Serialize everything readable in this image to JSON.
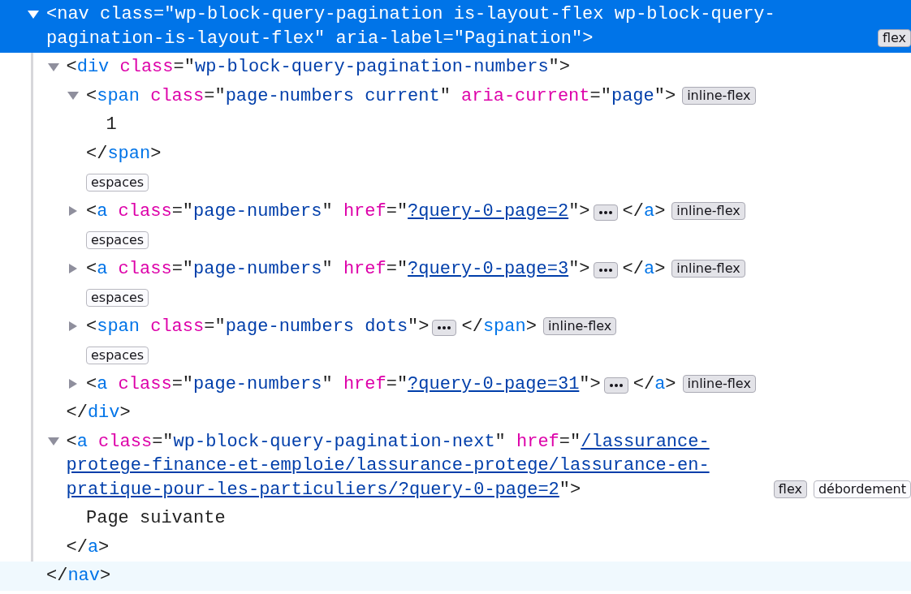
{
  "syntax": {
    "open": "<",
    "open_end": ">",
    "close": "</",
    "equals": "=",
    "quote": "\""
  },
  "tree": [
    {
      "kind": "element",
      "tag": "nav",
      "close_tag": "nav",
      "selected": true,
      "expanded": true,
      "close_hovered": true,
      "attributes": [
        {
          "name": "class",
          "value": "wp-block-query-pagination is-layout-flex wp-block-query-pagination-is-layout-flex",
          "link": false
        },
        {
          "name": "aria-label",
          "value": "Pagination",
          "link": false
        }
      ],
      "badges": [
        {
          "label": "flex",
          "kind": "display"
        }
      ],
      "children": [
        {
          "kind": "element",
          "tag": "div",
          "close_tag": "div",
          "selected": false,
          "expanded": true,
          "attributes": [
            {
              "name": "class",
              "value": "wp-block-query-pagination-numbers",
              "link": false
            }
          ],
          "children": [
            {
              "kind": "element",
              "tag": "span",
              "close_tag": "span",
              "selected": false,
              "expanded": true,
              "attributes": [
                {
                  "name": "class",
                  "value": "page-numbers current",
                  "link": false
                },
                {
                  "name": "aria-current",
                  "value": "page",
                  "link": false
                }
              ],
              "badges": [
                {
                  "label": "inline-flex",
                  "kind": "display"
                }
              ],
              "children": [
                {
                  "kind": "text",
                  "text": "1"
                }
              ]
            },
            {
              "kind": "whitespace",
              "label": "espaces"
            },
            {
              "kind": "element",
              "tag": "a",
              "close_tag": "a",
              "selected": false,
              "expanded": false,
              "attributes": [
                {
                  "name": "class",
                  "value": "page-numbers",
                  "link": false
                },
                {
                  "name": "href",
                  "value": "?query-0-page=2",
                  "link": true
                }
              ],
              "badges": [
                {
                  "label": "inline-flex",
                  "kind": "display"
                }
              ]
            },
            {
              "kind": "whitespace",
              "label": "espaces"
            },
            {
              "kind": "element",
              "tag": "a",
              "close_tag": "a",
              "selected": false,
              "expanded": false,
              "attributes": [
                {
                  "name": "class",
                  "value": "page-numbers",
                  "link": false
                },
                {
                  "name": "href",
                  "value": "?query-0-page=3",
                  "link": true
                }
              ],
              "badges": [
                {
                  "label": "inline-flex",
                  "kind": "display"
                }
              ]
            },
            {
              "kind": "whitespace",
              "label": "espaces"
            },
            {
              "kind": "element",
              "tag": "span",
              "close_tag": "span",
              "selected": false,
              "expanded": false,
              "attributes": [
                {
                  "name": "class",
                  "value": "page-numbers dots",
                  "link": false
                }
              ],
              "badges": [
                {
                  "label": "inline-flex",
                  "kind": "display"
                }
              ]
            },
            {
              "kind": "whitespace",
              "label": "espaces"
            },
            {
              "kind": "element",
              "tag": "a",
              "close_tag": "a",
              "selected": false,
              "expanded": false,
              "attributes": [
                {
                  "name": "class",
                  "value": "page-numbers",
                  "link": false
                },
                {
                  "name": "href",
                  "value": "?query-0-page=31",
                  "link": true
                }
              ],
              "badges": [
                {
                  "label": "inline-flex",
                  "kind": "display"
                }
              ]
            }
          ]
        },
        {
          "kind": "element",
          "tag": "a",
          "close_tag": "a",
          "selected": false,
          "expanded": true,
          "attributes": [
            {
              "name": "class",
              "value": "wp-block-query-pagination-next",
              "link": false
            },
            {
              "name": "href",
              "value": "/lassurance-protege-finance-et-emploie/lassurance-protege/lassurance-en-pratique-pour-les-particuliers/?query-0-page=2",
              "link": true
            }
          ],
          "badges": [
            {
              "label": "flex",
              "kind": "display"
            },
            {
              "label": "débordement",
              "kind": "info"
            }
          ],
          "children": [
            {
              "kind": "text",
              "text": "Page suivante"
            }
          ]
        }
      ]
    }
  ]
}
